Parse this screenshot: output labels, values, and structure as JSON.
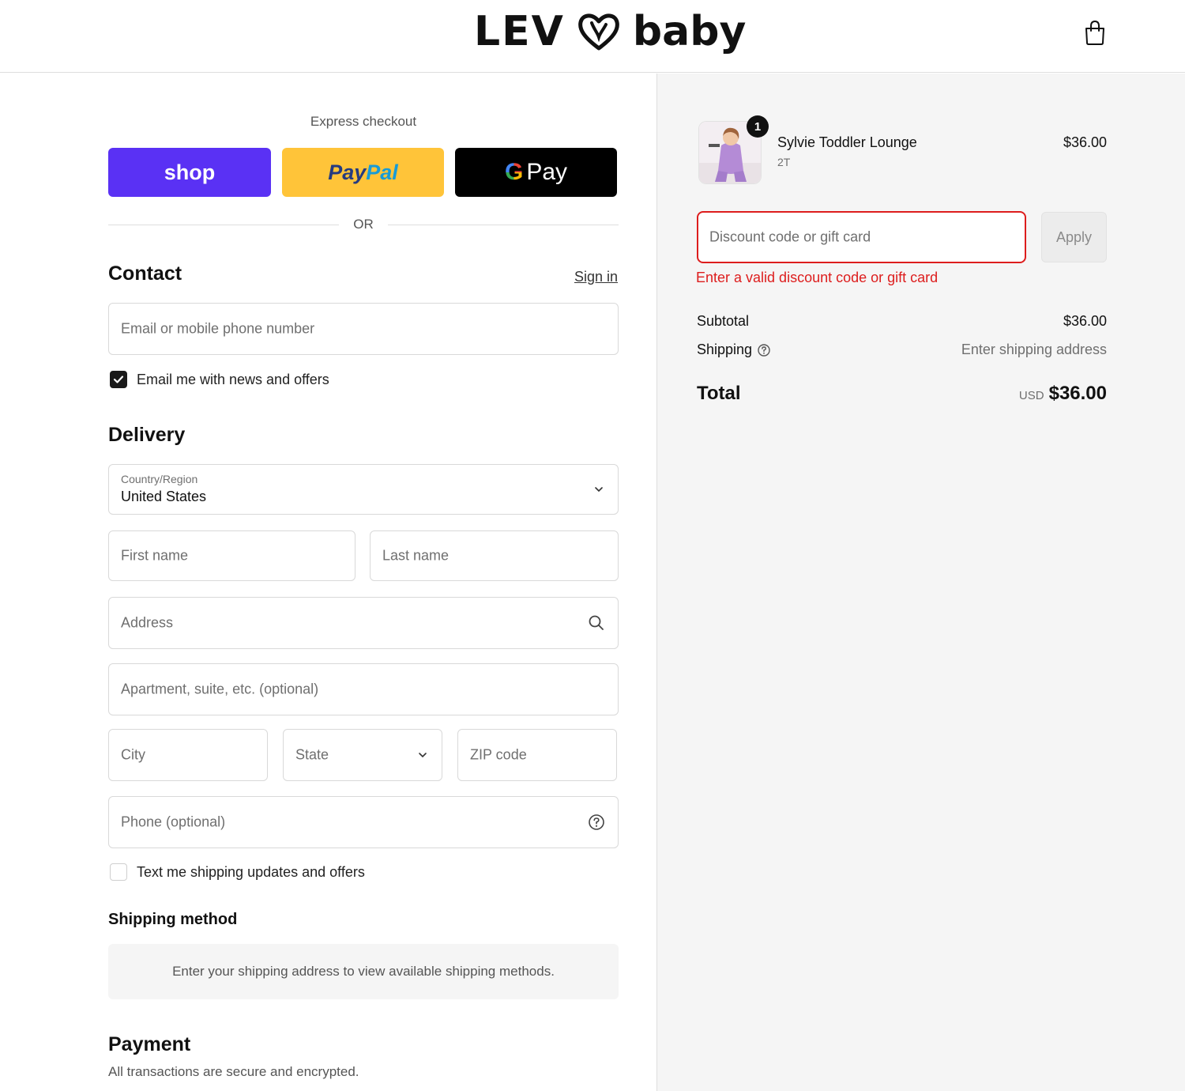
{
  "header": {
    "brand_left": "LEV",
    "brand_right": "baby",
    "cart_icon": "shopping-bag-icon"
  },
  "express": {
    "title": "Express checkout",
    "shop_label": "shop",
    "paypal_label_1": "Pay",
    "paypal_label_2": "Pal",
    "gpay_g": "G",
    "gpay_label": "Pay",
    "or_label": "OR"
  },
  "contact": {
    "title": "Contact",
    "sign_in": "Sign in",
    "email_placeholder": "Email or mobile phone number",
    "news_label": "Email me with news and offers",
    "news_checked": true
  },
  "delivery": {
    "title": "Delivery",
    "country_label": "Country/Region",
    "country_value": "United States",
    "first_name": "First name",
    "last_name": "Last name",
    "address": "Address",
    "apartment": "Apartment, suite, etc. (optional)",
    "city": "City",
    "state": "State",
    "zip": "ZIP code",
    "phone": "Phone (optional)",
    "sms_label": "Text me shipping updates and offers",
    "sms_checked": false
  },
  "shipping_method": {
    "title": "Shipping method",
    "info": "Enter your shipping address to view available shipping methods."
  },
  "payment": {
    "title": "Payment",
    "subtitle": "All transactions are secure and encrypted."
  },
  "order": {
    "item": {
      "name": "Sylvie Toddler Lounge",
      "variant": "2T",
      "price": "$36.00",
      "quantity": "1"
    },
    "discount_placeholder": "Discount code or gift card",
    "apply_label": "Apply",
    "discount_error": "Enter a valid discount code or gift card",
    "subtotal_label": "Subtotal",
    "subtotal_value": "$36.00",
    "shipping_label": "Shipping",
    "shipping_value": "Enter shipping address",
    "total_label": "Total",
    "currency": "USD",
    "total_value": "$36.00"
  },
  "colors": {
    "shop": "#5a31f4",
    "paypal": "#ffc439",
    "gpay": "#000000",
    "error": "#dd1d1d",
    "sidebar_bg": "#f5f5f5"
  }
}
